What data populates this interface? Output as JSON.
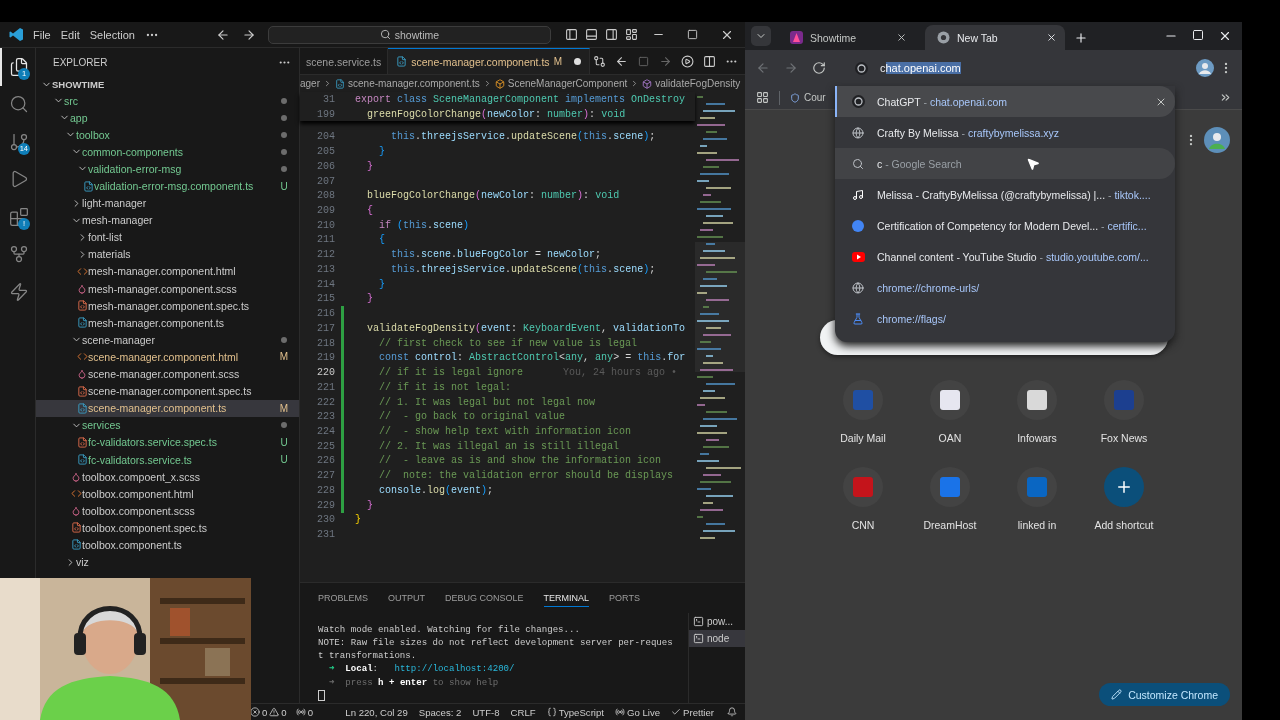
{
  "vscode": {
    "menu": [
      {
        "label": "File"
      },
      {
        "label": "Edit"
      },
      {
        "label": "Selection"
      }
    ],
    "command_center": "showtime",
    "activity_bar": [
      {
        "kind": "explorer",
        "selected": true,
        "badge": "1"
      },
      {
        "kind": "search",
        "selected": false
      },
      {
        "kind": "source-control",
        "selected": false,
        "badge": "14"
      },
      {
        "kind": "run",
        "selected": false
      },
      {
        "kind": "extensions",
        "selected": false,
        "badge": "!"
      },
      {
        "kind": "git-graph",
        "selected": false
      },
      {
        "kind": "thunder",
        "selected": false
      }
    ],
    "explorer": {
      "title": "EXPLORER",
      "root": {
        "label": "SHOWTIME",
        "expanded": true
      },
      "tree": [
        {
          "label": "src",
          "kind": "folder",
          "untracked": true,
          "modified": false,
          "changes": true,
          "expanded": true,
          "selected": false,
          "children": [
            {
              "label": "app",
              "kind": "folder",
              "untracked": true,
              "modified": false,
              "changes": true,
              "expanded": true,
              "selected": false,
              "children": [
                {
                  "label": "toolbox",
                  "kind": "folder",
                  "untracked": true,
                  "modified": false,
                  "changes": true,
                  "expanded": true,
                  "selected": false,
                  "children": [
                    {
                      "label": "common-components",
                      "kind": "folder",
                      "untracked": true,
                      "modified": false,
                      "changes": true,
                      "expanded": true,
                      "selected": false,
                      "children": [
                        {
                          "label": "validation-error-msg",
                          "kind": "folder",
                          "untracked": true,
                          "modified": false,
                          "changes": true,
                          "expanded": true,
                          "selected": false,
                          "children": [
                            {
                              "label": "validation-error-msg.component.ts",
                              "kind": "ts",
                              "untracked": true,
                              "modified": false,
                              "git": "U",
                              "selected": false
                            }
                          ]
                        }
                      ]
                    },
                    {
                      "label": "light-manager",
                      "kind": "folder",
                      "untracked": false,
                      "modified": false,
                      "changes": false,
                      "expanded": false,
                      "selected": false
                    },
                    {
                      "label": "mesh-manager",
                      "kind": "folder",
                      "untracked": false,
                      "modified": false,
                      "changes": false,
                      "expanded": true,
                      "selected": false,
                      "children": [
                        {
                          "label": "font-list",
                          "kind": "folder",
                          "untracked": false,
                          "modified": false,
                          "changes": false,
                          "expanded": false,
                          "selected": false
                        },
                        {
                          "label": "materials",
                          "kind": "folder",
                          "untracked": false,
                          "modified": false,
                          "changes": false,
                          "expanded": false,
                          "selected": false
                        },
                        {
                          "label": "mesh-manager.component.html",
                          "kind": "html",
                          "untracked": false,
                          "modified": false,
                          "selected": false
                        },
                        {
                          "label": "mesh-manager.component.scss",
                          "kind": "scss",
                          "untracked": false,
                          "modified": false,
                          "selected": false
                        },
                        {
                          "label": "mesh-manager.component.spec.ts",
                          "kind": "spec",
                          "untracked": false,
                          "modified": false,
                          "selected": false
                        },
                        {
                          "label": "mesh-manager.component.ts",
                          "kind": "ts",
                          "untracked": false,
                          "modified": false,
                          "selected": false
                        }
                      ]
                    },
                    {
                      "label": "scene-manager",
                      "kind": "folder",
                      "untracked": false,
                      "modified": false,
                      "changes": true,
                      "expanded": true,
                      "selected": false,
                      "children": [
                        {
                          "label": "scene-manager.component.html",
                          "kind": "html",
                          "untracked": false,
                          "modified": true,
                          "git": "M",
                          "selected": false
                        },
                        {
                          "label": "scene-manager.component.scss",
                          "kind": "scss",
                          "untracked": false,
                          "modified": false,
                          "selected": false
                        },
                        {
                          "label": "scene-manager.component.spec.ts",
                          "kind": "spec",
                          "untracked": false,
                          "modified": false,
                          "selected": false
                        },
                        {
                          "label": "scene-manager.component.ts",
                          "kind": "ts",
                          "untracked": false,
                          "modified": true,
                          "git": "M",
                          "selected": true
                        }
                      ]
                    },
                    {
                      "label": "services",
                      "kind": "folder",
                      "untracked": true,
                      "modified": false,
                      "changes": true,
                      "expanded": true,
                      "selected": false,
                      "children": [
                        {
                          "label": "fc-validators.service.spec.ts",
                          "kind": "spec",
                          "untracked": true,
                          "modified": false,
                          "git": "U",
                          "selected": false
                        },
                        {
                          "label": "fc-validators.service.ts",
                          "kind": "ts",
                          "untracked": true,
                          "modified": false,
                          "git": "U",
                          "selected": false
                        }
                      ]
                    },
                    {
                      "label": "toolbox.compoent_x.scss",
                      "kind": "scss",
                      "untracked": false,
                      "modified": false,
                      "selected": false
                    },
                    {
                      "label": "toolbox.component.html",
                      "kind": "html",
                      "untracked": false,
                      "modified": false,
                      "selected": false
                    },
                    {
                      "label": "toolbox.component.scss",
                      "kind": "scss",
                      "untracked": false,
                      "modified": false,
                      "selected": false
                    },
                    {
                      "label": "toolbox.component.spec.ts",
                      "kind": "spec",
                      "untracked": false,
                      "modified": false,
                      "selected": false
                    },
                    {
                      "label": "toolbox.component.ts",
                      "kind": "ts",
                      "untracked": false,
                      "modified": false,
                      "selected": false
                    }
                  ]
                },
                {
                  "label": "viz",
                  "kind": "folder",
                  "untracked": false,
                  "modified": false,
                  "changes": false,
                  "expanded": false,
                  "selected": false
                }
              ]
            }
          ]
        }
      ]
    },
    "editor": {
      "tabs": [
        {
          "label": "scene.service.ts",
          "selected": false
        },
        {
          "label": "scene-manager.component.ts",
          "selected": true,
          "git": "M",
          "dirty": true
        }
      ],
      "breadcrumbs": [
        {
          "label": "ager",
          "kind": "folder"
        },
        {
          "label": "scene-manager.component.ts",
          "kind": "ts"
        },
        {
          "label": "SceneManagerComponent",
          "kind": "class"
        },
        {
          "label": "validateFogDensity",
          "kind": "method"
        }
      ],
      "sticky": [
        {
          "number": "31",
          "tokens": [
            {
              "text": "export ",
              "kind": "ctrl"
            },
            {
              "text": "class ",
              "kind": "kw"
            },
            {
              "text": "SceneManagerComponent ",
              "kind": "type"
            },
            {
              "text": "implements ",
              "kind": "kw"
            },
            {
              "text": "OnDestroy",
              "kind": "type"
            }
          ]
        },
        {
          "number": "199",
          "tokens": [
            {
              "text": "  greenFogColorChange",
              "kind": "fn"
            },
            {
              "text": "(",
              "kind": "b2"
            },
            {
              "text": "newColor",
              "kind": "var"
            },
            {
              "text": ": ",
              "kind": "plain"
            },
            {
              "text": "number",
              "kind": "type"
            },
            {
              "text": ")",
              "kind": "b2"
            },
            {
              "text": ": ",
              "kind": "plain"
            },
            {
              "text": "void",
              "kind": "type"
            }
          ]
        }
      ],
      "lines": [
        {
          "number": "204",
          "current": false,
          "tokens": [
            {
              "text": "      this",
              "kind": "kw"
            },
            {
              "text": ".",
              "kind": "plain"
            },
            {
              "text": "threejsService",
              "kind": "var"
            },
            {
              "text": ".",
              "kind": "plain"
            },
            {
              "text": "updateScene",
              "kind": "fn"
            },
            {
              "text": "(",
              "kind": "b3"
            },
            {
              "text": "this",
              "kind": "kw"
            },
            {
              "text": ".",
              "kind": "plain"
            },
            {
              "text": "scene",
              "kind": "var"
            },
            {
              "text": ")",
              "kind": "b3"
            },
            {
              "text": ";",
              "kind": "plain"
            }
          ]
        },
        {
          "number": "205",
          "current": false,
          "tokens": [
            {
              "text": "    }",
              "kind": "b3"
            }
          ]
        },
        {
          "number": "206",
          "current": false,
          "tokens": [
            {
              "text": "  }",
              "kind": "b2"
            }
          ]
        },
        {
          "number": "207",
          "current": false
        },
        {
          "number": "208",
          "current": false,
          "tokens": [
            {
              "text": "  blueFogColorChange",
              "kind": "fn"
            },
            {
              "text": "(",
              "kind": "b2"
            },
            {
              "text": "newColor",
              "kind": "var"
            },
            {
              "text": ": ",
              "kind": "plain"
            },
            {
              "text": "number",
              "kind": "type"
            },
            {
              "text": ")",
              "kind": "b2"
            },
            {
              "text": ": ",
              "kind": "plain"
            },
            {
              "text": "void",
              "kind": "type"
            }
          ]
        },
        {
          "number": "209",
          "current": false,
          "tokens": [
            {
              "text": "  {",
              "kind": "b2"
            }
          ]
        },
        {
          "number": "210",
          "current": false,
          "tokens": [
            {
              "text": "    if ",
              "kind": "ctrl"
            },
            {
              "text": "(",
              "kind": "b3"
            },
            {
              "text": "this",
              "kind": "kw"
            },
            {
              "text": ".",
              "kind": "plain"
            },
            {
              "text": "scene",
              "kind": "var"
            },
            {
              "text": ")",
              "kind": "b3"
            }
          ]
        },
        {
          "number": "211",
          "current": false,
          "tokens": [
            {
              "text": "    {",
              "kind": "b3"
            }
          ]
        },
        {
          "number": "212",
          "current": false,
          "tokens": [
            {
              "text": "      this",
              "kind": "kw"
            },
            {
              "text": ".",
              "kind": "plain"
            },
            {
              "text": "scene",
              "kind": "var"
            },
            {
              "text": ".",
              "kind": "plain"
            },
            {
              "text": "blueFogColor",
              "kind": "var"
            },
            {
              "text": " = ",
              "kind": "plain"
            },
            {
              "text": "newColor",
              "kind": "var"
            },
            {
              "text": ";",
              "kind": "plain"
            }
          ]
        },
        {
          "number": "213",
          "current": false,
          "tokens": [
            {
              "text": "      this",
              "kind": "kw"
            },
            {
              "text": ".",
              "kind": "plain"
            },
            {
              "text": "threejsService",
              "kind": "var"
            },
            {
              "text": ".",
              "kind": "plain"
            },
            {
              "text": "updateScene",
              "kind": "fn"
            },
            {
              "text": "(",
              "kind": "b3"
            },
            {
              "text": "this",
              "kind": "kw"
            },
            {
              "text": ".",
              "kind": "plain"
            },
            {
              "text": "scene",
              "kind": "var"
            },
            {
              "text": ")",
              "kind": "b3"
            },
            {
              "text": ";",
              "kind": "plain"
            }
          ]
        },
        {
          "number": "214",
          "current": false,
          "tokens": [
            {
              "text": "    }",
              "kind": "b3"
            }
          ]
        },
        {
          "number": "215",
          "current": false,
          "tokens": [
            {
              "text": "  }",
              "kind": "b2"
            }
          ]
        },
        {
          "number": "216",
          "current": false
        },
        {
          "number": "217",
          "current": false,
          "tokens": [
            {
              "text": "  validateFogDensity",
              "kind": "fn"
            },
            {
              "text": "(",
              "kind": "b2"
            },
            {
              "text": "event",
              "kind": "var"
            },
            {
              "text": ": ",
              "kind": "plain"
            },
            {
              "text": "KeyboardEvent",
              "kind": "type"
            },
            {
              "text": ", ",
              "kind": "plain"
            },
            {
              "text": "validationTo",
              "kind": "var"
            }
          ]
        },
        {
          "number": "218",
          "current": false,
          "tokens": [
            {
              "text": "    // first check to see if new value is legal",
              "kind": "comment"
            }
          ]
        },
        {
          "number": "219",
          "current": false,
          "tokens": [
            {
              "text": "    const ",
              "kind": "kw"
            },
            {
              "text": "control",
              "kind": "var"
            },
            {
              "text": ": ",
              "kind": "plain"
            },
            {
              "text": "AbstractControl",
              "kind": "type"
            },
            {
              "text": "<",
              "kind": "plain"
            },
            {
              "text": "any",
              "kind": "type"
            },
            {
              "text": ", ",
              "kind": "plain"
            },
            {
              "text": "any",
              "kind": "type"
            },
            {
              "text": "> = ",
              "kind": "plain"
            },
            {
              "text": "this",
              "kind": "kw"
            },
            {
              "text": ".",
              "kind": "plain"
            },
            {
              "text": "for",
              "kind": "var"
            }
          ]
        },
        {
          "number": "220",
          "current": true,
          "blame": "You, 24 hours ago •",
          "tokens": [
            {
              "text": "    // if it is legal ignore",
              "kind": "comment"
            }
          ]
        },
        {
          "number": "221",
          "current": false,
          "tokens": [
            {
              "text": "    // if it is not legal:",
              "kind": "comment"
            }
          ]
        },
        {
          "number": "222",
          "current": false,
          "tokens": [
            {
              "text": "    // 1. It was legal but not legal now",
              "kind": "comment"
            }
          ]
        },
        {
          "number": "223",
          "current": false,
          "tokens": [
            {
              "text": "    //  - go back to original value",
              "kind": "comment"
            }
          ]
        },
        {
          "number": "224",
          "current": false,
          "tokens": [
            {
              "text": "    //  - show help text with information icon",
              "kind": "comment"
            }
          ]
        },
        {
          "number": "225",
          "current": false,
          "tokens": [
            {
              "text": "    // 2. It was illegal an is still illegal",
              "kind": "comment"
            }
          ]
        },
        {
          "number": "226",
          "current": false,
          "tokens": [
            {
              "text": "    //  - leave as is and show the information icon",
              "kind": "comment"
            }
          ]
        },
        {
          "number": "227",
          "current": false,
          "tokens": [
            {
              "text": "    //  note: the validation error should be displays",
              "kind": "comment"
            }
          ]
        },
        {
          "number": "228",
          "current": false,
          "tokens": [
            {
              "text": "    console",
              "kind": "var"
            },
            {
              "text": ".",
              "kind": "plain"
            },
            {
              "text": "log",
              "kind": "fn"
            },
            {
              "text": "(",
              "kind": "b3"
            },
            {
              "text": "event",
              "kind": "var"
            },
            {
              "text": ")",
              "kind": "b3"
            },
            {
              "text": ";",
              "kind": "plain"
            }
          ]
        },
        {
          "number": "229",
          "current": false,
          "tokens": [
            {
              "text": "  }",
              "kind": "b2"
            }
          ]
        },
        {
          "number": "230",
          "current": false,
          "tokens": [
            {
              "text": "}",
              "kind": "b1"
            }
          ]
        },
        {
          "number": "231",
          "current": false
        }
      ]
    },
    "panel": {
      "tabs": [
        {
          "label": "PROBLEMS",
          "selected": false
        },
        {
          "label": "OUTPUT",
          "selected": false
        },
        {
          "label": "DEBUG CONSOLE",
          "selected": false
        },
        {
          "label": "TERMINAL",
          "selected": true
        },
        {
          "label": "PORTS",
          "selected": false
        }
      ],
      "terminal": [
        {
          "segments": [
            {
              "text": "Watch mode enabled. Watching for file changes...",
              "kind": "plain"
            }
          ]
        },
        {
          "segments": [
            {
              "text": "NOTE: Raw file sizes do not reflect development server per-reques",
              "kind": "plain"
            }
          ]
        },
        {
          "segments": [
            {
              "text": "t transformations.",
              "kind": "plain"
            }
          ]
        },
        {
          "segments": [
            {
              "text": "  ➜  ",
              "kind": "green"
            },
            {
              "text": "Local",
              "kind": "bold"
            },
            {
              "text": ":   ",
              "kind": "plain"
            },
            {
              "text": "http://localhost:4200/",
              "kind": "cyan"
            }
          ]
        },
        {
          "segments": [
            {
              "text": "  ➜  press ",
              "kind": "dim"
            },
            {
              "text": "h + enter",
              "kind": "bold"
            },
            {
              "text": " to show help",
              "kind": "dim"
            }
          ]
        }
      ],
      "shells": [
        {
          "label": "pow...",
          "selected": false
        },
        {
          "label": "node",
          "selected": true
        }
      ]
    },
    "status_bar": {
      "errors": "0",
      "warnings": "0",
      "ports": "0",
      "items": [
        {
          "kind": "plain",
          "text": "Ln 220, Col 29"
        },
        {
          "kind": "plain",
          "text": "Spaces: 2"
        },
        {
          "kind": "plain",
          "text": "UTF-8"
        },
        {
          "kind": "plain",
          "text": "CRLF"
        },
        {
          "kind": "language",
          "text": "TypeScript"
        },
        {
          "kind": "live",
          "text": "Go Live"
        },
        {
          "kind": "prettier",
          "text": "Prettier"
        }
      ]
    }
  },
  "chrome": {
    "tabs": [
      {
        "title": "Showtime",
        "kind": "app",
        "selected": false
      },
      {
        "title": "New Tab",
        "kind": "chrome",
        "selected": true
      }
    ],
    "nav": [
      {
        "kind": "back",
        "disabled": true
      },
      {
        "kind": "forward",
        "disabled": true
      },
      {
        "kind": "reload",
        "disabled": false
      }
    ],
    "omnibox": {
      "typed": "c",
      "completion": "hat.openai.com"
    },
    "bookmarks": [
      {
        "label": "Cour"
      }
    ],
    "suggestions": [
      {
        "kind": "openai",
        "title": "ChatGPT",
        "sep": "-",
        "url": "chat.openai.com",
        "selected": true,
        "hovered": false
      },
      {
        "kind": "globe",
        "title": "Crafty By Melissa",
        "sep": "-",
        "url": "craftybymelissa.xyz",
        "selected": false,
        "hovered": false
      },
      {
        "kind": "search",
        "title": "c",
        "sep": "-",
        "detail": "Google Search",
        "selected": false,
        "hovered": true
      },
      {
        "kind": "tiktok",
        "title": "Melissa - CraftyByMelissa (@craftybymelissa) |...",
        "sep": "-",
        "url": "tiktok....",
        "selected": false,
        "hovered": false
      },
      {
        "kind": "meta",
        "title": "Certification of Competency for Modern Devel...",
        "sep": "-",
        "url": "certific...",
        "selected": false,
        "hovered": false
      },
      {
        "kind": "youtube",
        "title": "Channel content - YouTube Studio",
        "sep": "-",
        "url": "studio.youtube.com/...",
        "selected": false,
        "hovered": false
      },
      {
        "kind": "globe",
        "url": "chrome://chrome-urls/",
        "selected": false,
        "hovered": false
      },
      {
        "kind": "flask",
        "url": "chrome://flags/",
        "selected": false,
        "hovered": false
      }
    ],
    "shortcuts": [
      {
        "label": "Daily Mail",
        "kind": "site",
        "color": "#1f4fa3"
      },
      {
        "label": "OAN",
        "kind": "site",
        "color": "#e6e6f0"
      },
      {
        "label": "Infowars",
        "kind": "site",
        "color": "#d9d9d9"
      },
      {
        "label": "Fox News",
        "kind": "site",
        "color": "#1c3f8f"
      },
      {
        "label": "CNN",
        "kind": "site",
        "color": "#c4141b"
      },
      {
        "label": "DreamHost",
        "kind": "site",
        "color": "#1a73e8"
      },
      {
        "label": "linked in",
        "kind": "site",
        "color": "#0a66c2"
      },
      {
        "label": "Add shortcut",
        "kind": "add"
      }
    ],
    "customize_button": "Customize Chrome"
  }
}
